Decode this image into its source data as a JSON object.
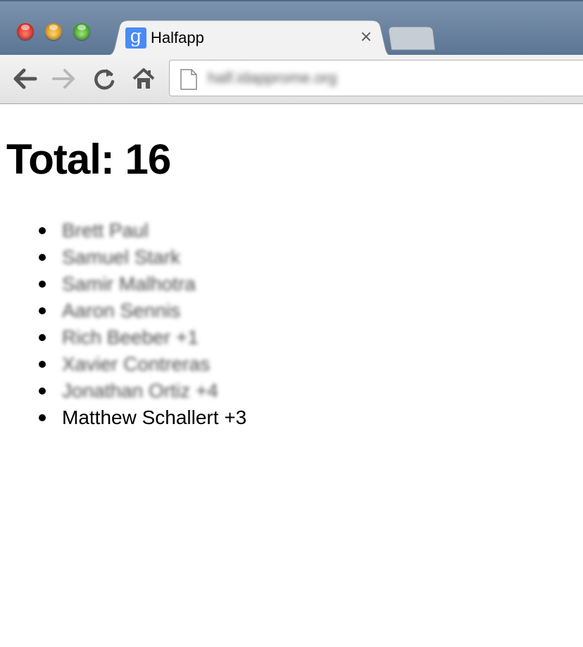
{
  "browser": {
    "tab": {
      "title": "Halfapp",
      "favicon_glyph": "g",
      "favicon_color": "#4a8bf5",
      "close_glyph": "×"
    },
    "address_bar": {
      "url": "half.idapprome.org"
    },
    "icons": {
      "back": "arrow-left-icon",
      "forward": "arrow-right-icon",
      "reload": "reload-icon",
      "home": "home-icon",
      "page": "document-icon"
    }
  },
  "page": {
    "heading": "Total: 16",
    "people": [
      {
        "name": "Brett Paul",
        "blurred": true
      },
      {
        "name": "Samuel Stark",
        "blurred": true
      },
      {
        "name": "Samir Malhotra",
        "blurred": true
      },
      {
        "name": "Aaron Sennis",
        "blurred": true
      },
      {
        "name": "Rich Beeber +1",
        "blurred": true
      },
      {
        "name": "Xavier Contreras",
        "blurred": true
      },
      {
        "name": "Jonathan Ortiz +4",
        "blurred": true
      },
      {
        "name": "Matthew Schallert +3",
        "blurred": false
      }
    ]
  }
}
